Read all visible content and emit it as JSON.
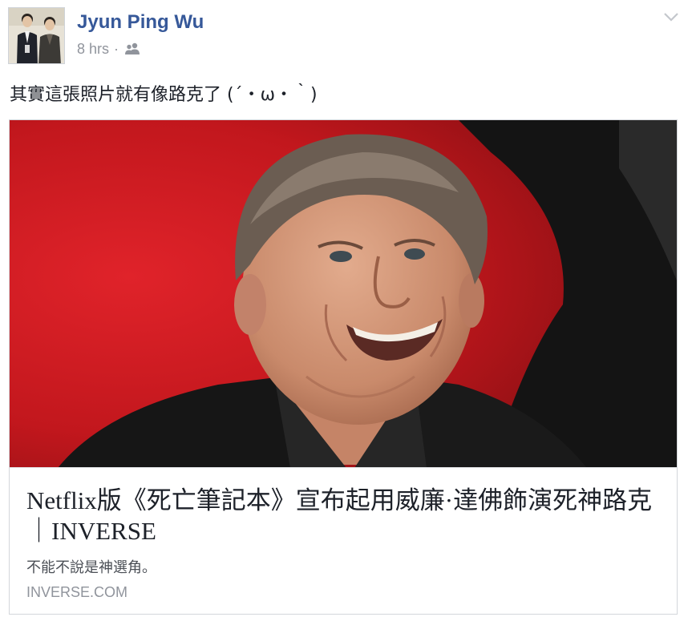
{
  "post": {
    "author_name": "Jyun Ping Wu",
    "timestamp": "8 hrs",
    "separator": "·",
    "audience_icon": "friends-icon",
    "menu_icon": "chevron-down-icon",
    "status_text": "其實這張照片就有像路克了 (´・ω・｀)"
  },
  "link_card": {
    "title": "Netflix版《死亡筆記本》宣布起用威廉·達佛飾演死神路克｜INVERSE",
    "description": "不能不說是神選角。",
    "domain": "INVERSE.COM"
  },
  "colors": {
    "author": "#365899",
    "meta": "#90949c",
    "text": "#1d2129",
    "card_border": "#d3d6db",
    "photo_background": "#c7161c"
  }
}
